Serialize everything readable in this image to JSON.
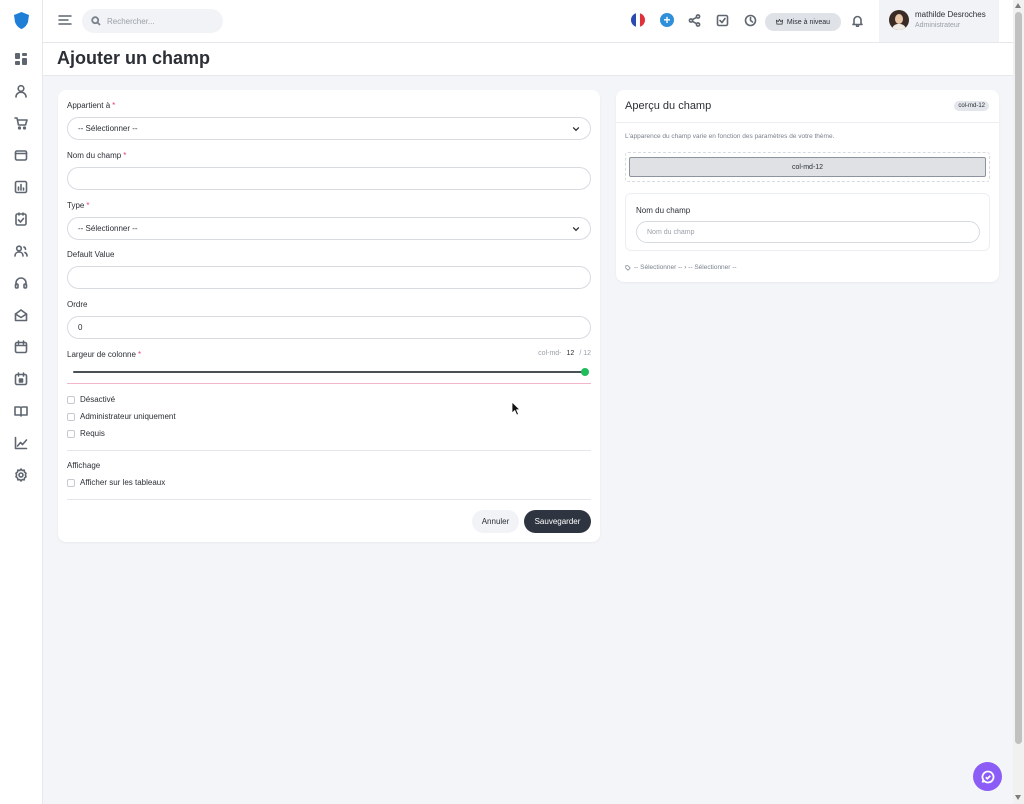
{
  "topbar": {
    "search_placeholder": "Rechercher...",
    "upgrade_label": "Mise à niveau",
    "user": {
      "name": "mathilde Desroches",
      "role": "Administrateur"
    }
  },
  "page": {
    "title": "Ajouter un champ"
  },
  "form": {
    "belongs_to": {
      "label": "Appartient à",
      "value": "-- Sélectionner --"
    },
    "field_name": {
      "label": "Nom du champ",
      "value": ""
    },
    "type": {
      "label": "Type",
      "value": "-- Sélectionner --"
    },
    "default_value": {
      "label": "Default Value",
      "value": ""
    },
    "order": {
      "label": "Ordre",
      "value": "0"
    },
    "column_width": {
      "label": "Largeur de colonne",
      "prefix": "col-md-",
      "value": "12",
      "max": "/ 12",
      "level": 12
    },
    "checkboxes": [
      "Désactivé",
      "Administrateur uniquement",
      "Requis"
    ],
    "display": {
      "label": "Affichage",
      "option": "Afficher sur les tableaux"
    },
    "buttons": {
      "cancel": "Annuler",
      "save": "Sauvegarder"
    }
  },
  "preview": {
    "title": "Aperçu du champ",
    "badge": "col-md-12",
    "description": "L'apparence du champ varie en fonction des paramètres de votre thème.",
    "column_label": "col-md-12",
    "field_label": "Nom du champ",
    "field_placeholder": "Nom du champ",
    "path_text": "-- Sélectionner -- › -- Sélectionner --"
  },
  "colors": {
    "accent_green": "#1fbd5c",
    "save_button": "#2f3540",
    "chat_button": "#8b5cf6",
    "brand_blue": "#1f7fd6"
  },
  "icons": {
    "sidebar": [
      "dashboard-icon",
      "user-icon",
      "cart-icon",
      "wallet-icon",
      "chart-icon",
      "clipboard-check-icon",
      "team-icon",
      "headset-icon",
      "mail-open-icon",
      "calendar-icon",
      "calendar-check-icon",
      "book-icon",
      "trending-icon",
      "settings-icon"
    ]
  }
}
